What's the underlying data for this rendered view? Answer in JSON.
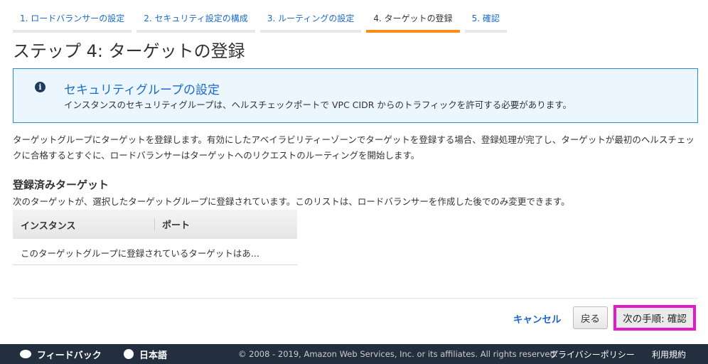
{
  "steps": [
    "1. ロードバランサーの設定",
    "2. セキュリティ設定の構成",
    "3. ルーティングの設定",
    "4. ターゲットの登録",
    "5. 確認"
  ],
  "title": "ステップ 4: ターゲットの登録",
  "alert": {
    "icon": "info-icon",
    "title": "セキュリティグループの設定",
    "message": "インスタンスのセキュリティグループは、ヘルスチェックポートで VPC CIDR からのトラフィックを許可する必要があります。"
  },
  "description": "ターゲットグループにターゲットを登録します。有効にしたアベイラビリティーゾーンでターゲットを登録する場合、登録処理が完了し、ターゲットが最初のヘルスチェックに合格するとすぐに、ロードバランサーはターゲットへのリクエストのルーティングを開始します。",
  "registered": {
    "heading": "登録済みターゲット",
    "description": "次のターゲットが、選択したターゲットグループに登録されています。このリストは、ロードバランサーを作成した後でのみ変更できます。",
    "columns": [
      "インスタンス",
      "ポート"
    ],
    "empty": "このターゲットグループに登録されているターゲットはあ..."
  },
  "actions": {
    "cancel": "キャンセル",
    "back": "戻る",
    "next": "次の手順: 確認"
  },
  "footer": {
    "feedback": "フィードバック",
    "language": "日本語",
    "copyright": "© 2008 - 2019, Amazon Web Services, Inc. or its affiliates. All rights reserved.",
    "privacy": "プライバシーポリシー",
    "terms": "利用規約"
  }
}
